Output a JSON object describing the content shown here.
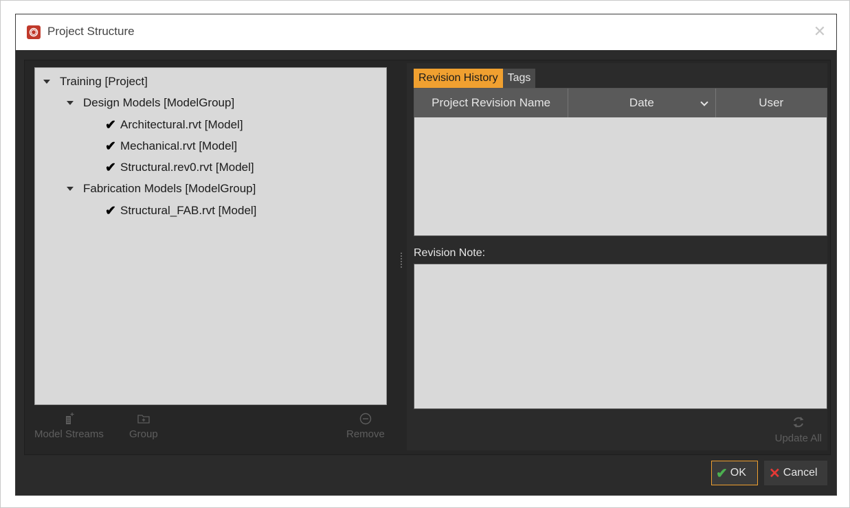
{
  "window": {
    "title": "Project Structure",
    "close_glyph": "✕"
  },
  "tree": {
    "root": {
      "label": "Training [Project]"
    },
    "groups": [
      {
        "label": "Design Models [ModelGroup]",
        "models": [
          "Architectural.rvt [Model]",
          "Mechanical.rvt [Model]",
          "Structural.rev0.rvt [Model]"
        ]
      },
      {
        "label": "Fabrication Models [ModelGroup]",
        "models": [
          "Structural_FAB.rvt [Model]"
        ]
      }
    ],
    "check_glyph": "✔"
  },
  "left_toolbar": {
    "model_streams": "Model Streams",
    "group": "Group",
    "remove": "Remove"
  },
  "right": {
    "tabs": [
      "Revision History",
      "Tags"
    ],
    "columns": [
      "Project Revision Name",
      "Date",
      "User"
    ],
    "revision_note_label": "Revision Note:",
    "update_all": "Update All"
  },
  "footer": {
    "ok": "OK",
    "cancel": "Cancel",
    "ok_glyph": "✔",
    "cancel_glyph": "✕"
  },
  "colors": {
    "accent": "#f0a030",
    "app_icon": "#c0392b",
    "ok_check": "#4caf50",
    "cancel_x": "#e53935"
  }
}
